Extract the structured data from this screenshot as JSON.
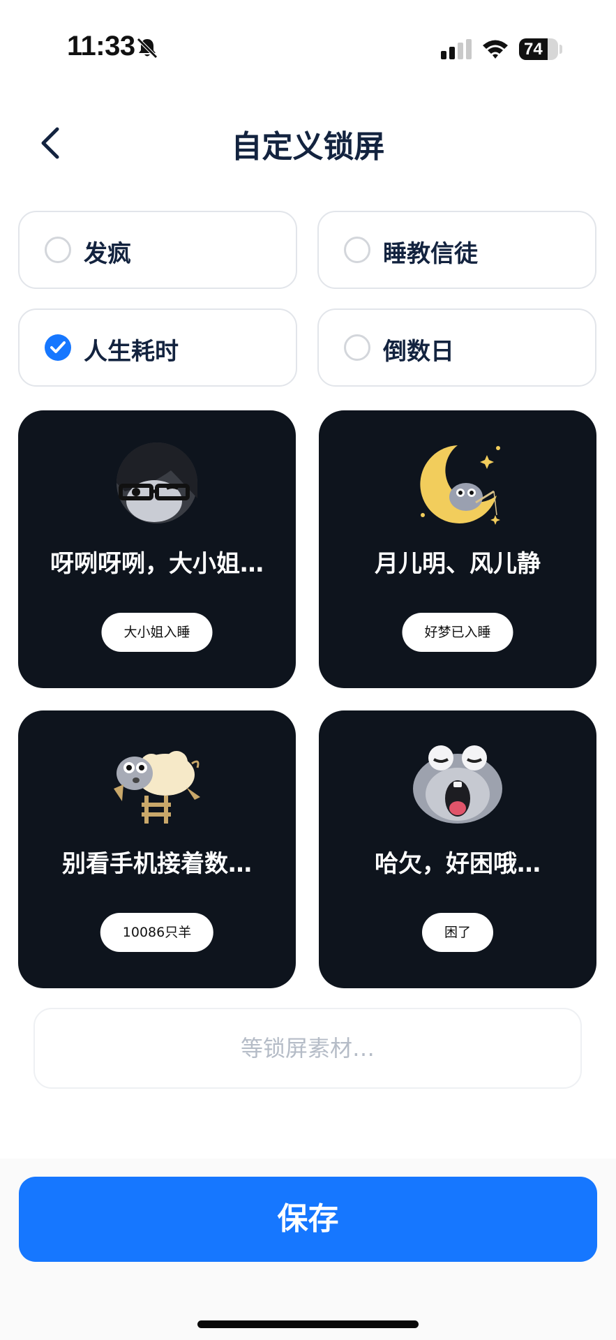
{
  "status_bar": {
    "time": "11:33",
    "battery_percent": "74",
    "battery_level": 0.74
  },
  "nav": {
    "title": "自定义锁屏"
  },
  "options": [
    {
      "label": "发疯",
      "checked": false
    },
    {
      "label": "睡教信徒",
      "checked": false
    },
    {
      "label": "人生耗时",
      "checked": true
    },
    {
      "label": "倒数日",
      "checked": false
    }
  ],
  "cards": [
    {
      "caption": "呀咧呀咧，大小姐…",
      "button": "大小姐入睡",
      "icon": "girl-with-glasses-icon"
    },
    {
      "caption": "月儿明、风儿静",
      "button": "好梦已入睡",
      "icon": "moon-creature-icon"
    },
    {
      "caption": "别看手机接着数…",
      "button": "10086只羊",
      "icon": "jumping-sheep-icon"
    },
    {
      "caption": "哈欠，好困哦…",
      "button": "困了",
      "icon": "yawning-blob-icon"
    }
  ],
  "loading_text": "等锁屏素材…",
  "save_label": "保存",
  "colors": {
    "accent": "#1677ff",
    "card_bg": "#0e141d",
    "title_text": "#13233f"
  }
}
